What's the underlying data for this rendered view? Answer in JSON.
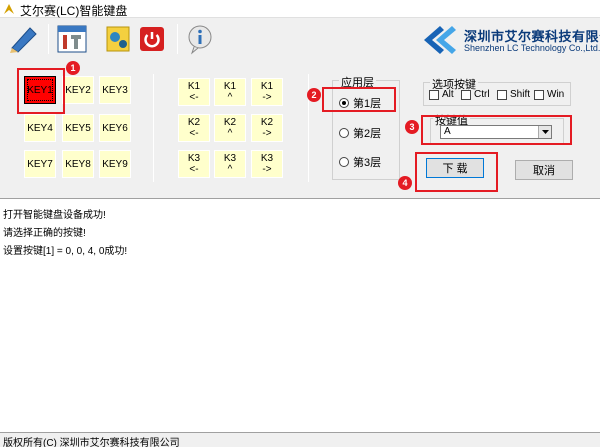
{
  "window": {
    "title": "艾尔赛(LC)智能键盘"
  },
  "toolbar": {
    "buttons": [
      {
        "icon": "pencil-icon"
      },
      {
        "icon": "tools-icon"
      },
      {
        "icon": "gears-icon"
      },
      {
        "icon": "power-icon"
      },
      {
        "icon": "info-icon"
      }
    ]
  },
  "logo": {
    "cn": "深圳市艾尔赛科技有限公司",
    "en": "Shenzhen LC Technology Co.,Ltd."
  },
  "keys": [
    "KEY1",
    "KEY2",
    "KEY3",
    "KEY4",
    "KEY5",
    "KEY6",
    "KEY7",
    "KEY8",
    "KEY9"
  ],
  "knobs": [
    {
      "label": "K1",
      "left": "<-",
      "press": "^",
      "right": "->"
    },
    {
      "label": "K2",
      "left": "<-",
      "press": "^",
      "right": "->"
    },
    {
      "label": "K3",
      "left": "<-",
      "press": "^",
      "right": "->"
    }
  ],
  "layer_group": {
    "title": "应用层",
    "options": [
      "第1层",
      "第2层",
      "第3层"
    ],
    "selected": "第1层"
  },
  "options_group": {
    "title": "选项按键",
    "modifiers": [
      "Alt",
      "Ctrl",
      "Shift",
      "Win"
    ]
  },
  "keyvalue_group": {
    "title": "按键值",
    "value": "A"
  },
  "buttons": {
    "download": "下 载",
    "cancel": "取消"
  },
  "annotations": [
    "1",
    "2",
    "3",
    "4"
  ],
  "log_lines": [
    "打开智能键盘设备成功!",
    "请选择正确的按键!",
    "设置按键[1] = 0,  0,  4, 0成功!"
  ],
  "status": "版权所有(C) 深圳市艾尔赛科技有限公司",
  "colors": {
    "active_key": "#ff0000",
    "key_bg": "#ffffcc",
    "highlight": "#e41b23"
  }
}
